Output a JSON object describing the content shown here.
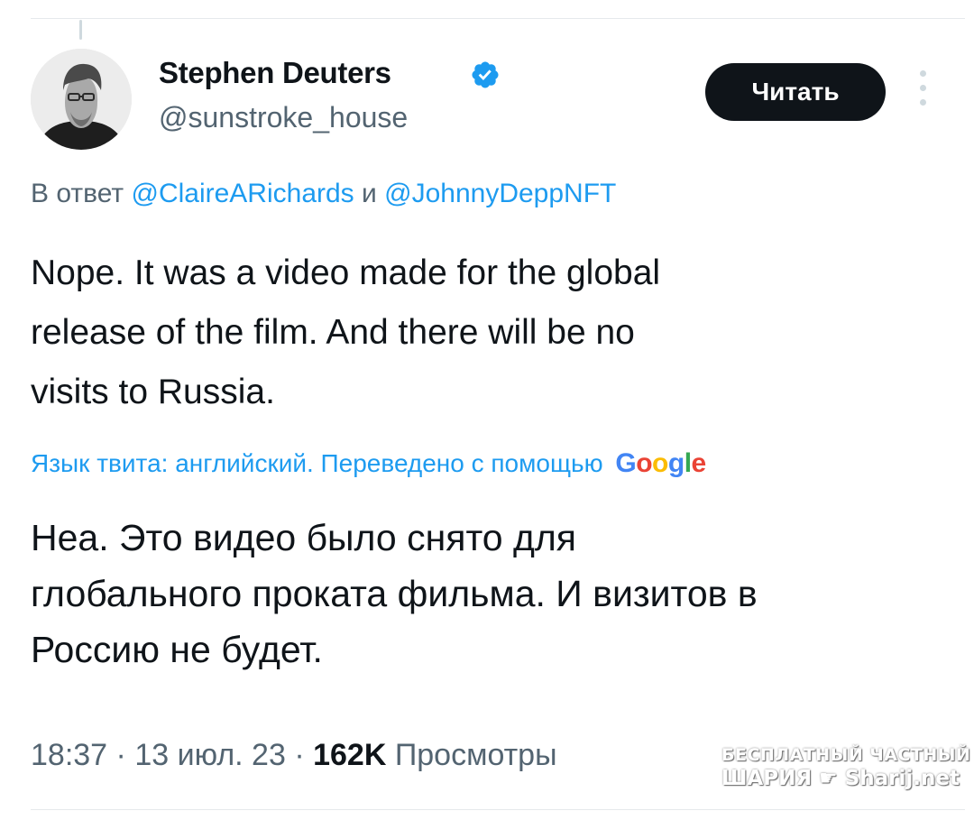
{
  "author": {
    "display_name": "Stephen Deuters",
    "handle": "@sunstroke_house",
    "verified": true,
    "verified_color": "#1d9bf0"
  },
  "follow_button": {
    "label": "Читать"
  },
  "reply": {
    "prefix": "В ответ ",
    "mention_1": "@ClaireARichards",
    "joiner": " и ",
    "mention_2": "@JohnnyDeppNFT"
  },
  "tweet": {
    "lines": [
      "Nope. It was a video made for the global",
      "release of the film. And there will be no",
      "visits to Russia."
    ]
  },
  "translation": {
    "label": "Язык твита: английский. Переведено с помощью",
    "provider": "Google",
    "lines": [
      "Неа. Это видео было снято для",
      "глобального проката фильма. И визитов в",
      "Россию не будет."
    ]
  },
  "meta": {
    "time": "18:37",
    "date": "13 июл. 23",
    "separator": " · ",
    "views_count": "162K",
    "views_label": " Просмотры"
  },
  "watermark": {
    "line_1": "БЕСПЛАТНЫЙ ЧАСТНЫЙ",
    "line_2_left": "ШАРИЯ",
    "line_2_right": "Sharij.net"
  },
  "colors": {
    "text_primary": "#0f1419",
    "text_secondary": "#536471",
    "link": "#1d9bf0",
    "button_bg": "#0f1419"
  },
  "icons": [
    "verified-badge-icon",
    "more-options-icon",
    "pointing-hand-icon"
  ]
}
